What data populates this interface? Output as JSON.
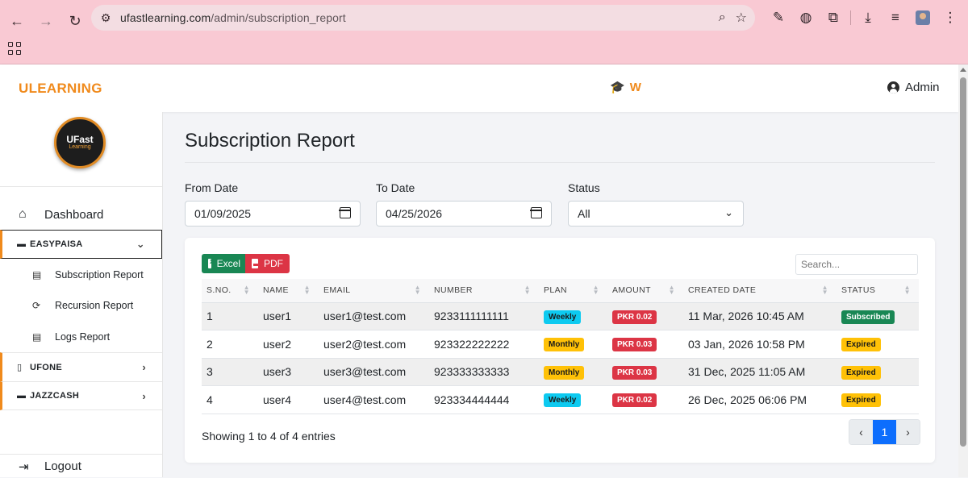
{
  "browser": {
    "url_host": "ufastlearning.com",
    "url_path": "/admin/subscription_report"
  },
  "header": {
    "brand": "ULEARNING",
    "center_logo_text": "W",
    "admin_label": "Admin"
  },
  "sidebar": {
    "logo_line1": "UFast",
    "logo_line2": "Learning",
    "dashboard": "Dashboard",
    "groups": [
      {
        "label": "EASYPAISA",
        "expanded": true
      },
      {
        "label": "UFONE",
        "expanded": false
      },
      {
        "label": "JAZZCASH",
        "expanded": false
      }
    ],
    "easypaisa_items": [
      "Subscription Report",
      "Recursion Report",
      "Logs Report"
    ],
    "logout": "Logout"
  },
  "main": {
    "title": "Subscription Report",
    "filters": {
      "from_label": "From Date",
      "from_value": "01/09/2025",
      "to_label": "To Date",
      "to_value": "04/25/2026",
      "status_label": "Status",
      "status_value": "All"
    },
    "buttons": {
      "excel": "Excel",
      "pdf": "PDF"
    },
    "search_placeholder": "Search...",
    "columns": [
      "S.NO.",
      "NAME",
      "EMAIL",
      "NUMBER",
      "PLAN",
      "AMOUNT",
      "CREATED DATE",
      "STATUS"
    ],
    "rows": [
      {
        "sno": "1",
        "name": "user1",
        "email": "user1@test.com",
        "number": "9233111111111",
        "plan": "Weekly",
        "amount": "PKR 0.02",
        "created": "11 Mar, 2026 10:45 AM",
        "status": "Subscribed"
      },
      {
        "sno": "2",
        "name": "user2",
        "email": "user2@test.com",
        "number": "923322222222",
        "plan": "Monthly",
        "amount": "PKR 0.03",
        "created": "03 Jan, 2026 10:58 PM",
        "status": "Expired"
      },
      {
        "sno": "3",
        "name": "user3",
        "email": "user3@test.com",
        "number": "923333333333",
        "plan": "Monthly",
        "amount": "PKR 0.03",
        "created": "31 Dec, 2025 11:05 AM",
        "status": "Expired"
      },
      {
        "sno": "4",
        "name": "user4",
        "email": "user4@test.com",
        "number": "923334444444",
        "plan": "Weekly",
        "amount": "PKR 0.02",
        "created": "26 Dec, 2025 06:06 PM",
        "status": "Expired"
      }
    ],
    "entries_info": "Showing 1 to 4 of 4 entries",
    "pagination": {
      "current": "1",
      "prev": "‹",
      "next": "›"
    }
  },
  "colors": {
    "brand": "#f08a1c",
    "success": "#198754",
    "danger": "#dc3545",
    "info": "#0dcaf0",
    "warning": "#ffc107",
    "primary": "#0d6efd"
  }
}
